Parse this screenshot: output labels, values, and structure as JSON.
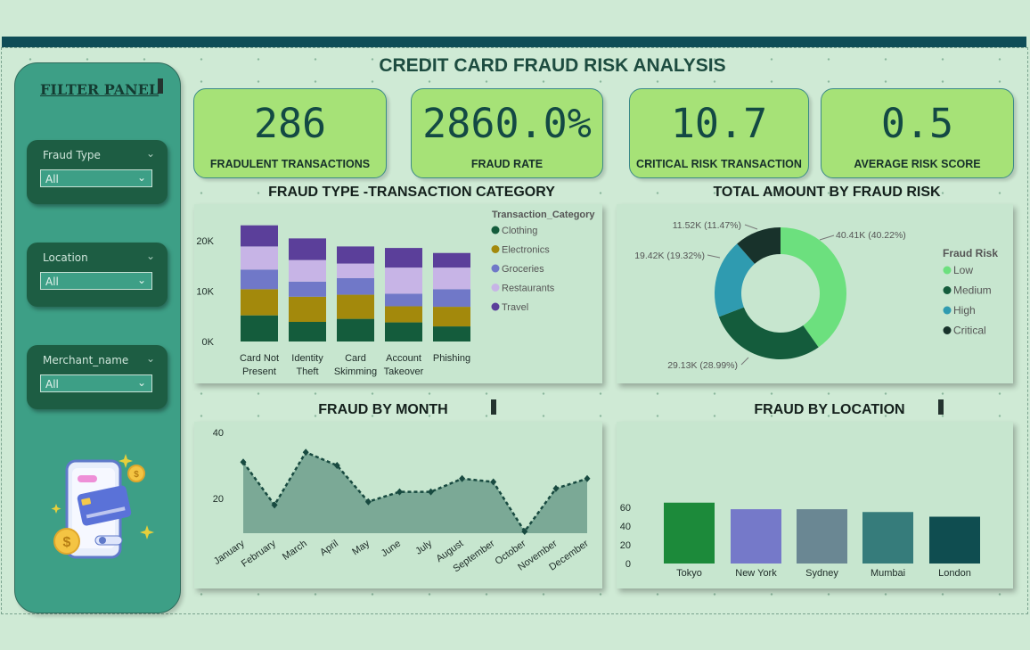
{
  "title": "CREDIT CARD FRAUD RISK ANALYSIS",
  "filters": {
    "title": "FILTER PANEL",
    "slicers": [
      {
        "label": "Fraud Type",
        "value": "All"
      },
      {
        "label": "Location",
        "value": "All"
      },
      {
        "label": "Merchant_name",
        "value": "All"
      }
    ]
  },
  "kpis": [
    {
      "value": "286",
      "label": "FRADULENT TRANSACTIONS"
    },
    {
      "value": "2860.0%",
      "label": "FRAUD RATE"
    },
    {
      "value": "10.7",
      "label": "CRITICAL RISK TRANSACTION"
    },
    {
      "value": "0.5",
      "label": "AVERAGE RISK SCORE"
    }
  ],
  "sections": {
    "fraud_type": "FRAUD TYPE -TRANSACTION CATEGORY",
    "amount_risk": "TOTAL AMOUNT BY FRAUD RISK",
    "by_month": "FRAUD BY MONTH",
    "by_location": "FRAUD BY LOCATION"
  },
  "colors": {
    "accent": "#0f4d57",
    "kpi_bg": "#a6e277",
    "sidebar": "#3d9f86"
  },
  "chart_data": [
    {
      "type": "bar",
      "stacked": true,
      "title": "FRAUD TYPE -TRANSACTION CATEGORY",
      "categories": [
        [
          "Card Not",
          "Present"
        ],
        [
          "Identity",
          "Theft"
        ],
        [
          "Card",
          "Skimming"
        ],
        [
          "Account",
          "Takeover"
        ],
        [
          "Phishing"
        ]
      ],
      "legend_title": "Transaction_Category",
      "legend_position": "right",
      "yticks": [
        "0K",
        "10K",
        "20K"
      ],
      "ylim": [
        0,
        25000
      ],
      "series": [
        {
          "name": "Clothing",
          "color": "#145c3c",
          "values": [
            5200,
            3900,
            4500,
            3800,
            3000
          ]
        },
        {
          "name": "Electronics",
          "color": "#a3890c",
          "values": [
            5200,
            5000,
            4800,
            3200,
            3900
          ]
        },
        {
          "name": "Groceries",
          "color": "#7078c8",
          "values": [
            3900,
            3000,
            3300,
            2500,
            3500
          ]
        },
        {
          "name": "Restaurants",
          "color": "#c7b4e6",
          "values": [
            4600,
            4300,
            2900,
            5200,
            4300
          ]
        },
        {
          "name": "Travel",
          "color": "#5b3f9a",
          "values": [
            4200,
            4300,
            3400,
            3900,
            2900
          ]
        }
      ]
    },
    {
      "type": "pie",
      "donut": true,
      "title": "TOTAL AMOUNT BY FRAUD RISK",
      "legend_title": "Fraud Risk",
      "legend_position": "right",
      "slices": [
        {
          "name": "Low",
          "value": 40.41,
          "label": "40.41K (40.22%)",
          "color": "#6ce07e"
        },
        {
          "name": "Medium",
          "value": 29.13,
          "label": "29.13K (28.99%)",
          "color": "#145c3c"
        },
        {
          "name": "High",
          "value": 19.42,
          "label": "19.42K (19.32%)",
          "color": "#2f9bb0"
        },
        {
          "name": "Critical",
          "value": 11.52,
          "label": "11.52K (11.47%)",
          "color": "#18322b"
        }
      ]
    },
    {
      "type": "area",
      "title": "FRAUD BY MONTH",
      "x": [
        "January",
        "February",
        "March",
        "April",
        "May",
        "June",
        "July",
        "August",
        "September",
        "October",
        "November",
        "December"
      ],
      "y": [
        31,
        18,
        34,
        30,
        19,
        22,
        22,
        26,
        25,
        10,
        23,
        26
      ],
      "yticks": [
        20,
        40
      ],
      "ylim": [
        10,
        40
      ],
      "color": "#7ba996",
      "line_color": "#184a40"
    },
    {
      "type": "bar",
      "title": "FRAUD BY LOCATION",
      "categories": [
        "Tokyo",
        "New York",
        "Sydney",
        "Mumbai",
        "London"
      ],
      "values": [
        65,
        58,
        58,
        55,
        50
      ],
      "colors": [
        "#1c8a3a",
        "#7579c9",
        "#6a8793",
        "#367c7b",
        "#0f4d50"
      ],
      "yticks": [
        0,
        20,
        40,
        60
      ],
      "ylim": [
        0,
        70
      ]
    }
  ]
}
